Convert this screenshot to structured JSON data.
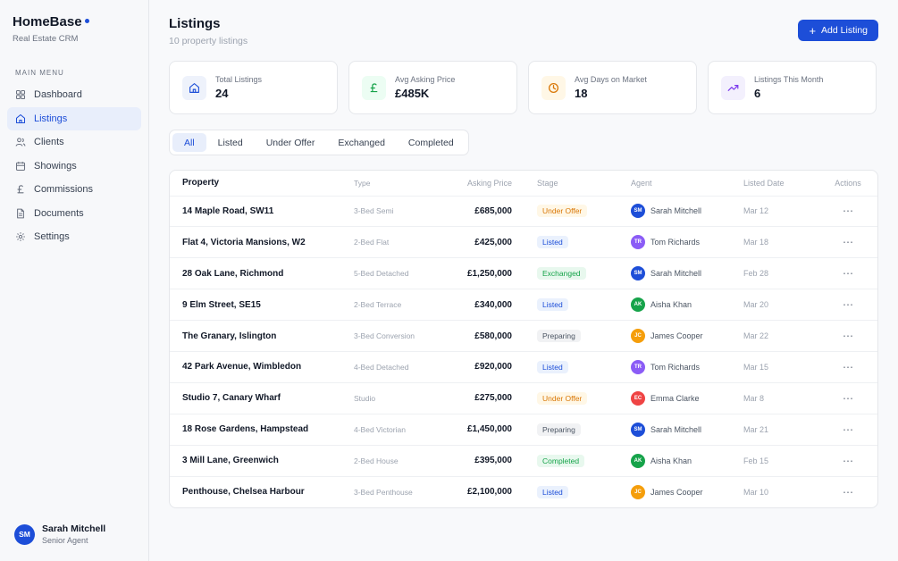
{
  "brand": {
    "name": "HomeBase",
    "subtitle": "Real Estate CRM"
  },
  "sidebar": {
    "menu_label": "MAIN MENU",
    "items": [
      {
        "label": "Dashboard",
        "icon": "grid-icon"
      },
      {
        "label": "Listings",
        "icon": "home-icon",
        "active": true
      },
      {
        "label": "Clients",
        "icon": "users-icon"
      },
      {
        "label": "Showings",
        "icon": "calendar-icon"
      },
      {
        "label": "Commissions",
        "icon": "pound-icon"
      },
      {
        "label": "Documents",
        "icon": "document-icon"
      },
      {
        "label": "Settings",
        "icon": "gear-icon"
      }
    ],
    "user": {
      "initials": "SM",
      "name": "Sarah Mitchell",
      "role": "Senior Agent"
    }
  },
  "header": {
    "title": "Listings",
    "subtitle": "10 property listings",
    "add_button": "Add Listing"
  },
  "stats": [
    {
      "label": "Total Listings",
      "value": "24",
      "icon": "home-icon",
      "bg": "#eef2fb",
      "fg": "#1d4ed8"
    },
    {
      "label": "Avg Asking Price",
      "value": "£485K",
      "icon": "pound-icon",
      "bg": "#ecfdf3",
      "fg": "#16a34a"
    },
    {
      "label": "Avg Days on Market",
      "value": "18",
      "icon": "clock-icon",
      "bg": "#fff7e6",
      "fg": "#d97706"
    },
    {
      "label": "Listings This Month",
      "value": "6",
      "icon": "trend-up-icon",
      "bg": "#f3f0fd",
      "fg": "#7c3aed"
    }
  ],
  "tabs": [
    {
      "label": "All",
      "active": true
    },
    {
      "label": "Listed"
    },
    {
      "label": "Under Offer"
    },
    {
      "label": "Exchanged"
    },
    {
      "label": "Completed"
    }
  ],
  "table": {
    "columns": [
      "Property",
      "Type",
      "Asking Price",
      "Stage",
      "Agent",
      "Listed Date",
      "Actions"
    ],
    "stage_colors": {
      "Under Offer": {
        "bg": "#fff7e6",
        "fg": "#d97706"
      },
      "Listed": {
        "bg": "#eaf1fd",
        "fg": "#1d4ed8"
      },
      "Exchanged": {
        "bg": "#e8f8ee",
        "fg": "#16a34a"
      },
      "Preparing": {
        "bg": "#f1f2f4",
        "fg": "#4b5563"
      },
      "Completed": {
        "bg": "#e8f8ee",
        "fg": "#16a34a"
      }
    },
    "rows": [
      {
        "property": "14 Maple Road, SW11",
        "type": "3-Bed Semi",
        "price": "£685,000",
        "stage": "Under Offer",
        "agent_initials": "SM",
        "agent": "Sarah Mitchell",
        "agent_color": "#1d4ed8",
        "date": "Mar 12"
      },
      {
        "property": "Flat 4, Victoria Mansions, W2",
        "type": "2-Bed Flat",
        "price": "£425,000",
        "stage": "Listed",
        "agent_initials": "TR",
        "agent": "Tom Richards",
        "agent_color": "#8b5cf6",
        "date": "Mar 18"
      },
      {
        "property": "28 Oak Lane, Richmond",
        "type": "5-Bed Detached",
        "price": "£1,250,000",
        "stage": "Exchanged",
        "agent_initials": "SM",
        "agent": "Sarah Mitchell",
        "agent_color": "#1d4ed8",
        "date": "Feb 28"
      },
      {
        "property": "9 Elm Street, SE15",
        "type": "2-Bed Terrace",
        "price": "£340,000",
        "stage": "Listed",
        "agent_initials": "AK",
        "agent": "Aisha Khan",
        "agent_color": "#16a34a",
        "date": "Mar 20"
      },
      {
        "property": "The Granary, Islington",
        "type": "3-Bed Conversion",
        "price": "£580,000",
        "stage": "Preparing",
        "agent_initials": "JC",
        "agent": "James Cooper",
        "agent_color": "#f59e0b",
        "date": "Mar 22"
      },
      {
        "property": "42 Park Avenue, Wimbledon",
        "type": "4-Bed Detached",
        "price": "£920,000",
        "stage": "Listed",
        "agent_initials": "TR",
        "agent": "Tom Richards",
        "agent_color": "#8b5cf6",
        "date": "Mar 15"
      },
      {
        "property": "Studio 7, Canary Wharf",
        "type": "Studio",
        "price": "£275,000",
        "stage": "Under Offer",
        "agent_initials": "EC",
        "agent": "Emma Clarke",
        "agent_color": "#ef4444",
        "date": "Mar 8"
      },
      {
        "property": "18 Rose Gardens, Hampstead",
        "type": "4-Bed Victorian",
        "price": "£1,450,000",
        "stage": "Preparing",
        "agent_initials": "SM",
        "agent": "Sarah Mitchell",
        "agent_color": "#1d4ed8",
        "date": "Mar 21"
      },
      {
        "property": "3 Mill Lane, Greenwich",
        "type": "2-Bed House",
        "price": "£395,000",
        "stage": "Completed",
        "agent_initials": "AK",
        "agent": "Aisha Khan",
        "agent_color": "#16a34a",
        "date": "Feb 15"
      },
      {
        "property": "Penthouse, Chelsea Harbour",
        "type": "3-Bed Penthouse",
        "price": "£2,100,000",
        "stage": "Listed",
        "agent_initials": "JC",
        "agent": "James Cooper",
        "agent_color": "#f59e0b",
        "date": "Mar 10"
      }
    ]
  }
}
